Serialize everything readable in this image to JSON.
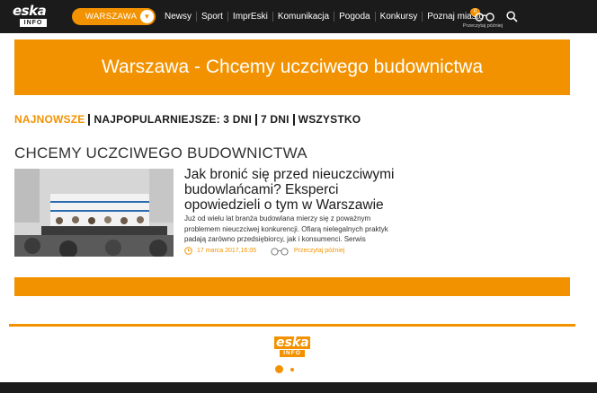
{
  "header": {
    "logo_text": "eska",
    "logo_sub": "INFO",
    "city": "WARSZAWA",
    "nav": [
      "Newsy",
      "Sport",
      "ImprEski",
      "Komunikacja",
      "Pogoda",
      "Konkursy",
      "Poznaj miasto"
    ],
    "read_later_count": "0",
    "read_later_label": "Przeczytaj później"
  },
  "banner": {
    "title": "Warszawa - Chcemy uczciwego budownictwa"
  },
  "filters": [
    "NAJNOWSZE",
    "NAJPOPULARNIEJSZE: 3 DNI",
    "7 DNI",
    "WSZYSTKO"
  ],
  "section": {
    "title": "CHCEMY UCZCIWEGO BUDOWNICTWA"
  },
  "article": {
    "title": "Jak bronić się przed nieuczciwymi budowlańcami? Eksperci opowiedzieli o tym w Warszawie",
    "lead": "Już od wielu lat branża budowlana mierzy się z poważnym problemem nieuczciwej konkurencji. Ofiarą nielegalnych praktyk padają zarówno przedsiębiorcy, jak i konsumenci. Serwis",
    "date": "17 marca 2017,16:05",
    "read_later": "Przeczytaj później"
  },
  "footer": {
    "logo_text": "eska",
    "logo_sub": "INFO"
  },
  "colors": {
    "accent": "#f39200",
    "dark": "#1b1b1b"
  }
}
